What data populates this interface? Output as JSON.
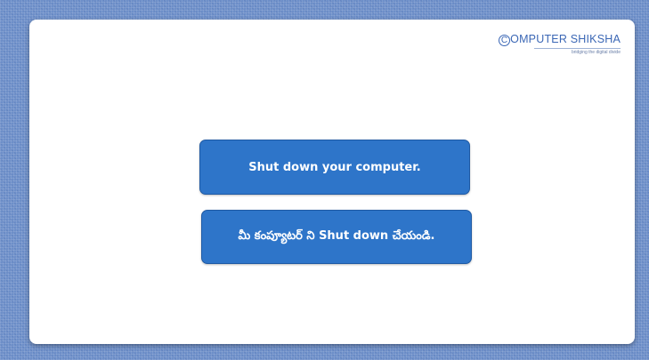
{
  "logo": {
    "initial": "C",
    "title_rest": "OMPUTER SHIKSHA",
    "tagline": "bridging the digital divide"
  },
  "messages": {
    "english": "Shut down your computer.",
    "telugu": "మీ కంప్యూటర్ ని Shut down చేయండి."
  },
  "colors": {
    "background": "#6d8fc9",
    "box_fill": "#2e75c9",
    "box_text": "#ffffff",
    "logo_text": "#3b67b5"
  }
}
